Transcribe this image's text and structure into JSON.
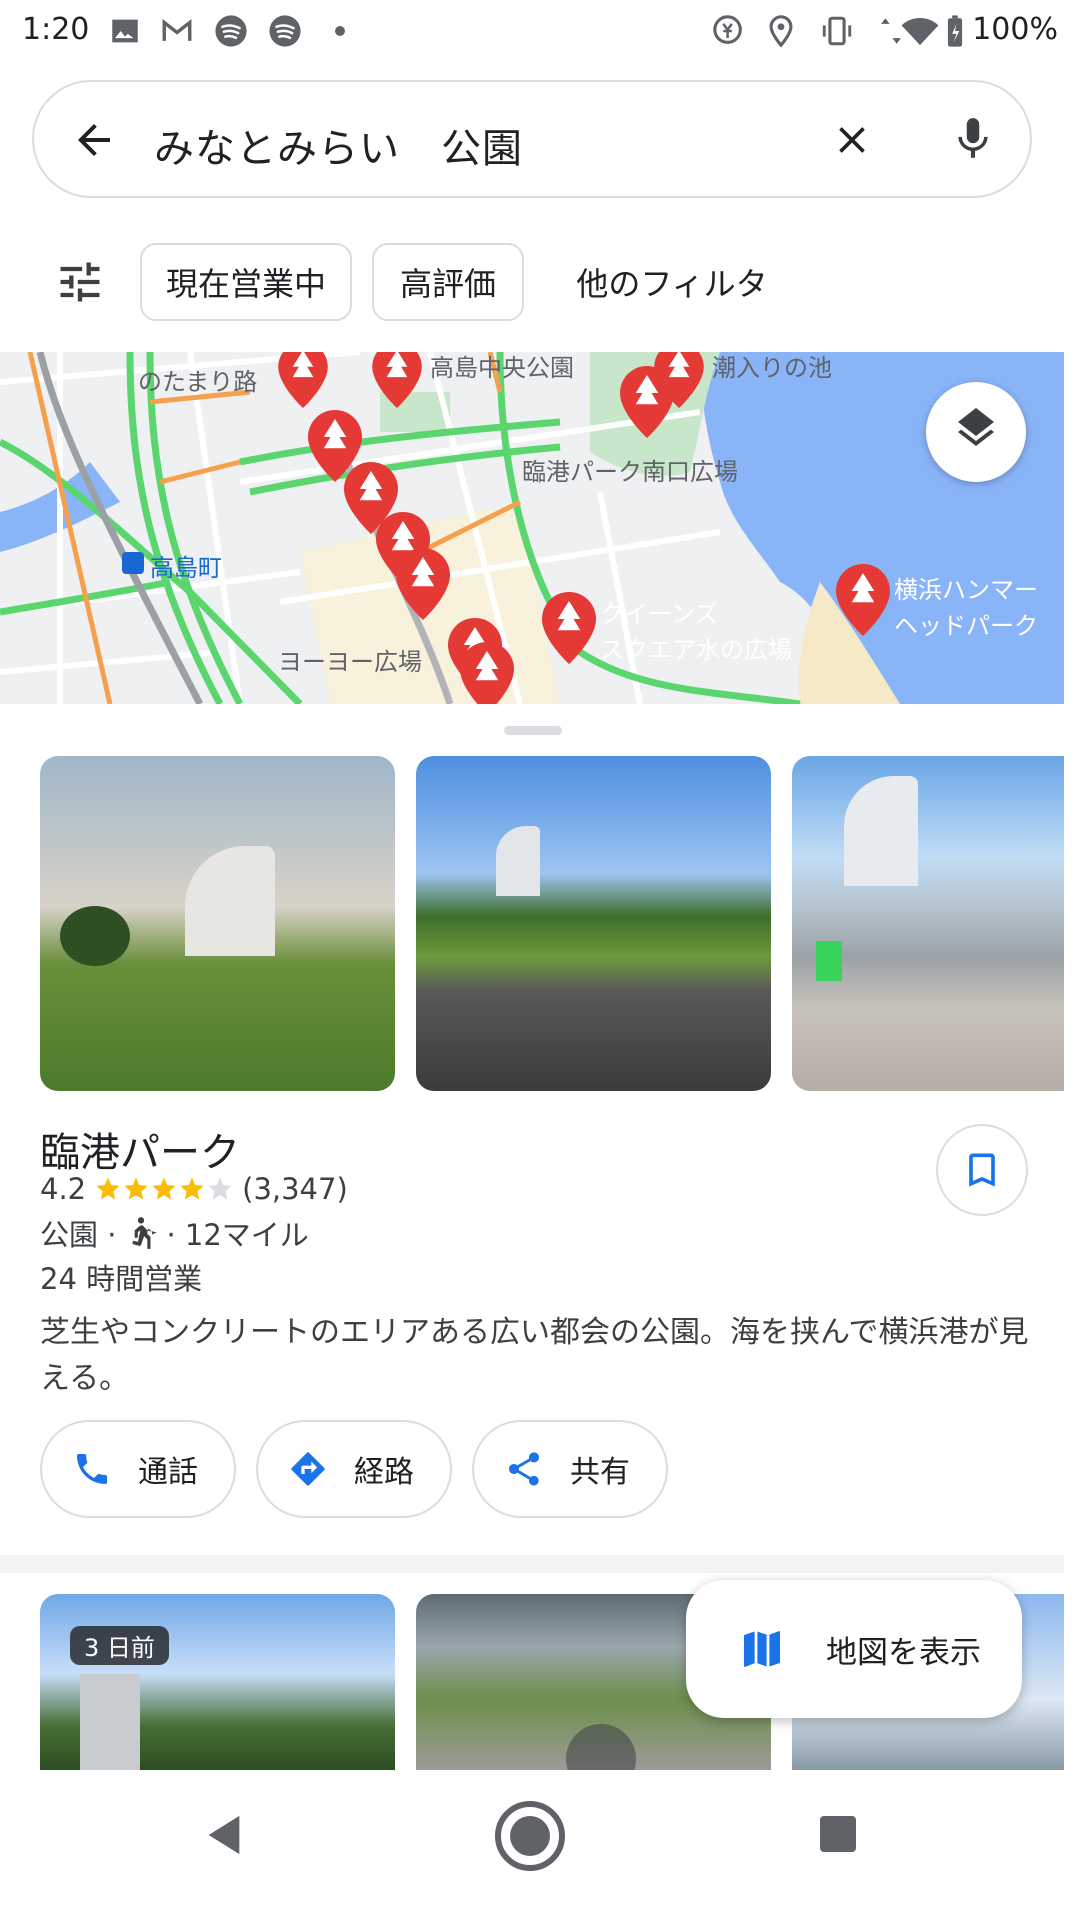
{
  "status_bar": {
    "time": "1:20",
    "battery": "100%"
  },
  "search": {
    "query": "みなとみらい　公園"
  },
  "filters": {
    "chips": [
      "現在営業中",
      "高評価",
      "他のフィルタ"
    ]
  },
  "map": {
    "labels": [
      "のたまり路",
      "高島中央公園",
      "潮入りの池",
      "臨港パーク南口広場",
      "高島町",
      "横浜ハンマー",
      "ヘッドパーク",
      "クイーンズ",
      "スクエア水の広場",
      "ヨーヨー広場"
    ]
  },
  "place": {
    "name": "臨港パーク",
    "rating": "4.2",
    "stars": 4.2,
    "reviews": "(3,347)",
    "category": "公園 ·",
    "distance": "· 12マイル",
    "hours": "24 時間営業",
    "description": "芝生やコンクリートのエリアある広い都会の公園。海を挟んで横浜港が見える。",
    "actions": [
      "通話",
      "経路",
      "共有"
    ]
  },
  "next": {
    "badge": "3 日前"
  },
  "fab": {
    "label": "地図を表示"
  },
  "colors": {
    "accent": "#1a73e8",
    "marker": "#e53935",
    "star": "#fbbc04",
    "water": "#8ab4f8",
    "park": "#c8e6c9"
  }
}
